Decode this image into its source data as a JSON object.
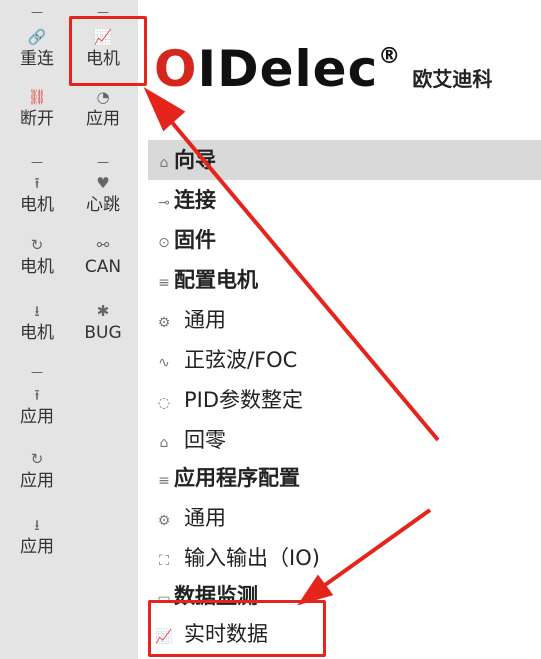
{
  "toolbar": {
    "col1": [
      {
        "icon": "link-icon",
        "glyph": "🔗",
        "label": "重连"
      },
      {
        "icon": "broken-link-icon",
        "glyph": "⛓",
        "label": "断开"
      },
      {
        "icon": "upload-icon",
        "glyph": "⭱",
        "label": "电机"
      },
      {
        "icon": "sync-icon",
        "glyph": "↻",
        "label": "电机"
      },
      {
        "icon": "download-icon",
        "glyph": "⭳",
        "label": "电机"
      },
      {
        "icon": "upload-icon",
        "glyph": "⭱",
        "label": "应用"
      },
      {
        "icon": "sync-icon",
        "glyph": "↻",
        "label": "应用"
      },
      {
        "icon": "download-icon",
        "glyph": "⭳",
        "label": "应用"
      }
    ],
    "col2": [
      {
        "icon": "chart-icon",
        "glyph": "📈",
        "label": "电机"
      },
      {
        "icon": "gauge-icon",
        "glyph": "◔",
        "label": "应用"
      },
      {
        "icon": "heartbeat-icon",
        "glyph": "♥",
        "label": "心跳"
      },
      {
        "icon": "can-network-icon",
        "glyph": "⚯",
        "label": "CAN"
      },
      {
        "icon": "bug-icon",
        "glyph": "✱",
        "label": "BUG"
      }
    ],
    "separator": "—"
  },
  "header": {
    "logo_o": "O",
    "logo_rest": "IDelec",
    "logo_reg": "®",
    "company_cn": "欧艾迪科"
  },
  "tree": [
    {
      "label": "向导",
      "glyph": "⌂",
      "level": 0,
      "selected": true
    },
    {
      "label": "连接",
      "glyph": "⊸",
      "level": 0
    },
    {
      "label": "固件",
      "glyph": "⊙",
      "level": 0
    },
    {
      "label": "配置电机",
      "glyph": "≡",
      "level": 0
    },
    {
      "label": "通用",
      "glyph": "⚙",
      "level": 1
    },
    {
      "label": "正弦波/FOC",
      "glyph": "∿",
      "level": 1
    },
    {
      "label": "PID参数整定",
      "glyph": "◌",
      "level": 1
    },
    {
      "label": "回零",
      "glyph": "⌂",
      "level": 1
    },
    {
      "label": "应用程序配置",
      "glyph": "≡",
      "level": 0
    },
    {
      "label": "通用",
      "glyph": "⚙",
      "level": 1
    },
    {
      "label": "输入输出（IO)",
      "glyph": "⛶",
      "level": 1
    },
    {
      "label": "数据监测",
      "glyph": "▭",
      "level": 0
    },
    {
      "label": "实时数据",
      "glyph": "📈",
      "level": 1
    }
  ],
  "colors": {
    "highlight": "#e5251c",
    "logo_accent": "#d4271e",
    "toolbar_bg": "#e4e4e4"
  }
}
